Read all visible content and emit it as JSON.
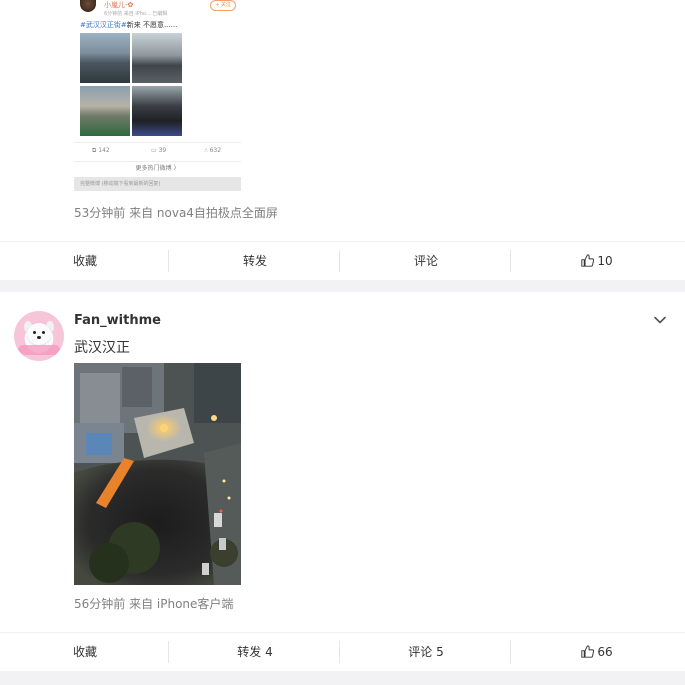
{
  "post1": {
    "embed": {
      "username": "小嵐儿-✿",
      "meta": "6分钟前  来自 iPho...  已编辑",
      "follow": "+ 关注",
      "tag": "#武汉汉正街#",
      "text": "新来 不愿意......",
      "reposts": "142",
      "comments": "39",
      "likes": "632",
      "more_link": "更多热门微博  〉",
      "footer": "完整微博 (移动端下看到最新的回复)"
    },
    "meta": "53分钟前  来自 nova4自拍极点全面屏",
    "actions": {
      "favorite": "收藏",
      "repost": "转发",
      "comment": "评论",
      "like": "10"
    }
  },
  "post2": {
    "username": "Fan_withme",
    "content": "武汉汉正",
    "meta": "56分钟前  来自 iPhone客户端",
    "actions": {
      "favorite": "收藏",
      "repost": "转发 4",
      "comment": "评论 5",
      "like": "66"
    }
  },
  "icons": {
    "like": "thumbs-up-icon",
    "expand": "chevron-down-icon"
  },
  "colors": {
    "link": "#3c76c6",
    "meta": "#808080",
    "text": "#333333",
    "separator": "#f2f2f5"
  }
}
